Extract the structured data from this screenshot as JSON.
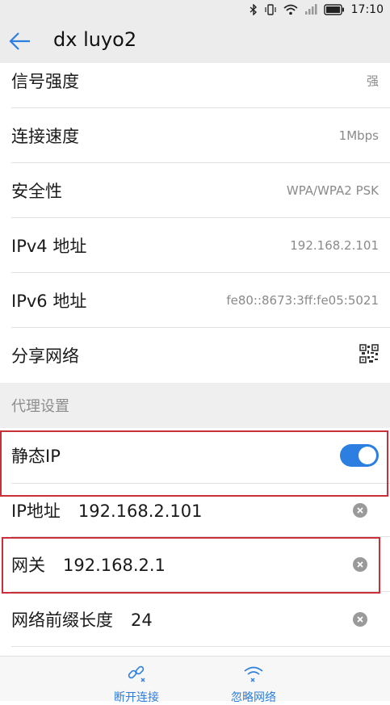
{
  "status_bar": {
    "time": "17:10"
  },
  "header": {
    "title": "dx luyo2"
  },
  "details": [
    {
      "label": "信号强度",
      "value": "强"
    },
    {
      "label": "连接速度",
      "value": "1Mbps"
    },
    {
      "label": "安全性",
      "value": "WPA/WPA2 PSK"
    },
    {
      "label": "IPv4 地址",
      "value": "192.168.2.101"
    },
    {
      "label": "IPv6 地址",
      "value": "fe80::8673:3ff:fe05:5021"
    },
    {
      "label": "分享网络",
      "value": ""
    }
  ],
  "proxy_section": {
    "label": "代理设置"
  },
  "static_ip": {
    "label": "静态IP",
    "enabled": true
  },
  "ip_fields": [
    {
      "label": "IP地址",
      "value": "192.168.2.101"
    },
    {
      "label": "网关",
      "value": "192.168.2.1"
    },
    {
      "label": "网络前缀长度",
      "value": "24"
    }
  ],
  "bottom_bar": {
    "disconnect_label": "断开连接",
    "forget_label": "忽略网络"
  },
  "colors": {
    "accent": "#2c7fe0",
    "highlight": "#c9303a"
  }
}
